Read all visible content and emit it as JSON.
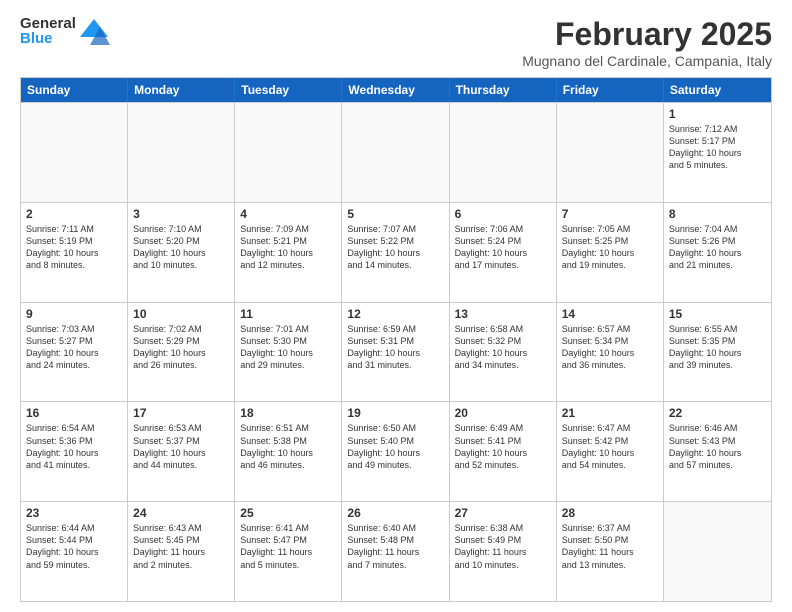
{
  "header": {
    "logo_general": "General",
    "logo_blue": "Blue",
    "month_title": "February 2025",
    "location": "Mugnano del Cardinale, Campania, Italy"
  },
  "weekdays": [
    "Sunday",
    "Monday",
    "Tuesday",
    "Wednesday",
    "Thursday",
    "Friday",
    "Saturday"
  ],
  "rows": [
    [
      {
        "day": "",
        "info": ""
      },
      {
        "day": "",
        "info": ""
      },
      {
        "day": "",
        "info": ""
      },
      {
        "day": "",
        "info": ""
      },
      {
        "day": "",
        "info": ""
      },
      {
        "day": "",
        "info": ""
      },
      {
        "day": "1",
        "info": "Sunrise: 7:12 AM\nSunset: 5:17 PM\nDaylight: 10 hours\nand 5 minutes."
      }
    ],
    [
      {
        "day": "2",
        "info": "Sunrise: 7:11 AM\nSunset: 5:19 PM\nDaylight: 10 hours\nand 8 minutes."
      },
      {
        "day": "3",
        "info": "Sunrise: 7:10 AM\nSunset: 5:20 PM\nDaylight: 10 hours\nand 10 minutes."
      },
      {
        "day": "4",
        "info": "Sunrise: 7:09 AM\nSunset: 5:21 PM\nDaylight: 10 hours\nand 12 minutes."
      },
      {
        "day": "5",
        "info": "Sunrise: 7:07 AM\nSunset: 5:22 PM\nDaylight: 10 hours\nand 14 minutes."
      },
      {
        "day": "6",
        "info": "Sunrise: 7:06 AM\nSunset: 5:24 PM\nDaylight: 10 hours\nand 17 minutes."
      },
      {
        "day": "7",
        "info": "Sunrise: 7:05 AM\nSunset: 5:25 PM\nDaylight: 10 hours\nand 19 minutes."
      },
      {
        "day": "8",
        "info": "Sunrise: 7:04 AM\nSunset: 5:26 PM\nDaylight: 10 hours\nand 21 minutes."
      }
    ],
    [
      {
        "day": "9",
        "info": "Sunrise: 7:03 AM\nSunset: 5:27 PM\nDaylight: 10 hours\nand 24 minutes."
      },
      {
        "day": "10",
        "info": "Sunrise: 7:02 AM\nSunset: 5:29 PM\nDaylight: 10 hours\nand 26 minutes."
      },
      {
        "day": "11",
        "info": "Sunrise: 7:01 AM\nSunset: 5:30 PM\nDaylight: 10 hours\nand 29 minutes."
      },
      {
        "day": "12",
        "info": "Sunrise: 6:59 AM\nSunset: 5:31 PM\nDaylight: 10 hours\nand 31 minutes."
      },
      {
        "day": "13",
        "info": "Sunrise: 6:58 AM\nSunset: 5:32 PM\nDaylight: 10 hours\nand 34 minutes."
      },
      {
        "day": "14",
        "info": "Sunrise: 6:57 AM\nSunset: 5:34 PM\nDaylight: 10 hours\nand 36 minutes."
      },
      {
        "day": "15",
        "info": "Sunrise: 6:55 AM\nSunset: 5:35 PM\nDaylight: 10 hours\nand 39 minutes."
      }
    ],
    [
      {
        "day": "16",
        "info": "Sunrise: 6:54 AM\nSunset: 5:36 PM\nDaylight: 10 hours\nand 41 minutes."
      },
      {
        "day": "17",
        "info": "Sunrise: 6:53 AM\nSunset: 5:37 PM\nDaylight: 10 hours\nand 44 minutes."
      },
      {
        "day": "18",
        "info": "Sunrise: 6:51 AM\nSunset: 5:38 PM\nDaylight: 10 hours\nand 46 minutes."
      },
      {
        "day": "19",
        "info": "Sunrise: 6:50 AM\nSunset: 5:40 PM\nDaylight: 10 hours\nand 49 minutes."
      },
      {
        "day": "20",
        "info": "Sunrise: 6:49 AM\nSunset: 5:41 PM\nDaylight: 10 hours\nand 52 minutes."
      },
      {
        "day": "21",
        "info": "Sunrise: 6:47 AM\nSunset: 5:42 PM\nDaylight: 10 hours\nand 54 minutes."
      },
      {
        "day": "22",
        "info": "Sunrise: 6:46 AM\nSunset: 5:43 PM\nDaylight: 10 hours\nand 57 minutes."
      }
    ],
    [
      {
        "day": "23",
        "info": "Sunrise: 6:44 AM\nSunset: 5:44 PM\nDaylight: 10 hours\nand 59 minutes."
      },
      {
        "day": "24",
        "info": "Sunrise: 6:43 AM\nSunset: 5:45 PM\nDaylight: 11 hours\nand 2 minutes."
      },
      {
        "day": "25",
        "info": "Sunrise: 6:41 AM\nSunset: 5:47 PM\nDaylight: 11 hours\nand 5 minutes."
      },
      {
        "day": "26",
        "info": "Sunrise: 6:40 AM\nSunset: 5:48 PM\nDaylight: 11 hours\nand 7 minutes."
      },
      {
        "day": "27",
        "info": "Sunrise: 6:38 AM\nSunset: 5:49 PM\nDaylight: 11 hours\nand 10 minutes."
      },
      {
        "day": "28",
        "info": "Sunrise: 6:37 AM\nSunset: 5:50 PM\nDaylight: 11 hours\nand 13 minutes."
      },
      {
        "day": "",
        "info": ""
      }
    ]
  ]
}
